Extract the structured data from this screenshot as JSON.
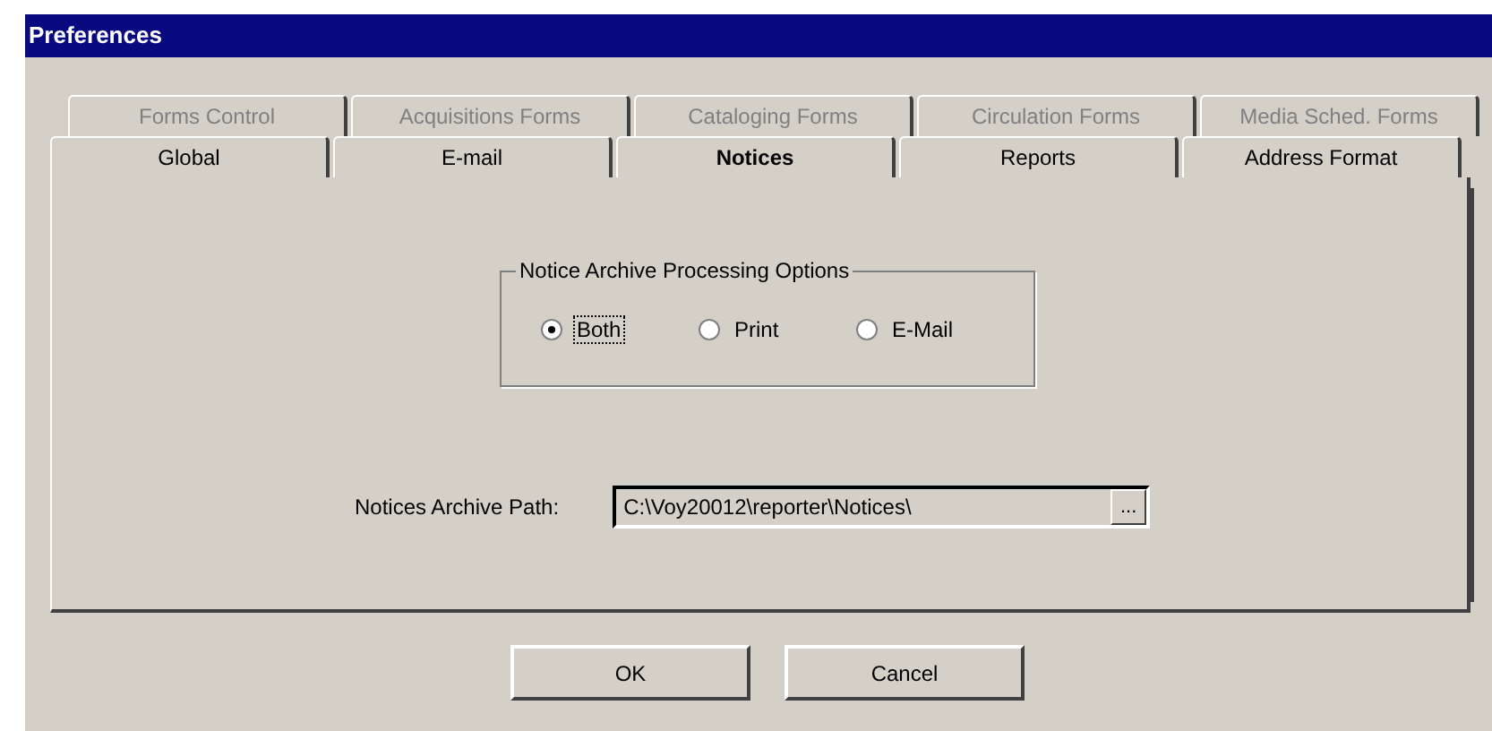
{
  "window": {
    "title": "Preferences"
  },
  "tab_rows": [
    {
      "tabs": [
        {
          "label": "Forms Control",
          "selected": false,
          "disabled": true
        },
        {
          "label": "Acquisitions Forms",
          "selected": false,
          "disabled": true
        },
        {
          "label": "Cataloging Forms",
          "selected": false,
          "disabled": true
        },
        {
          "label": "Circulation Forms",
          "selected": false,
          "disabled": true
        },
        {
          "label": "Media Sched. Forms",
          "selected": false,
          "disabled": true
        }
      ]
    },
    {
      "tabs": [
        {
          "label": "Global",
          "selected": false,
          "disabled": false
        },
        {
          "label": "E-mail",
          "selected": false,
          "disabled": false
        },
        {
          "label": "Notices",
          "selected": true,
          "disabled": false
        },
        {
          "label": "Reports",
          "selected": false,
          "disabled": false
        },
        {
          "label": "Address Format",
          "selected": false,
          "disabled": false
        }
      ]
    }
  ],
  "group": {
    "title": "Notice Archive Processing Options",
    "options": [
      {
        "label": "Both",
        "selected": true
      },
      {
        "label": "Print",
        "selected": false
      },
      {
        "label": "E-Mail",
        "selected": false
      }
    ]
  },
  "path": {
    "label": "Notices Archive Path:",
    "value": "C:\\Voy20012\\reporter\\Notices\\",
    "browse": "..."
  },
  "buttons": [
    "OK",
    "Cancel"
  ]
}
